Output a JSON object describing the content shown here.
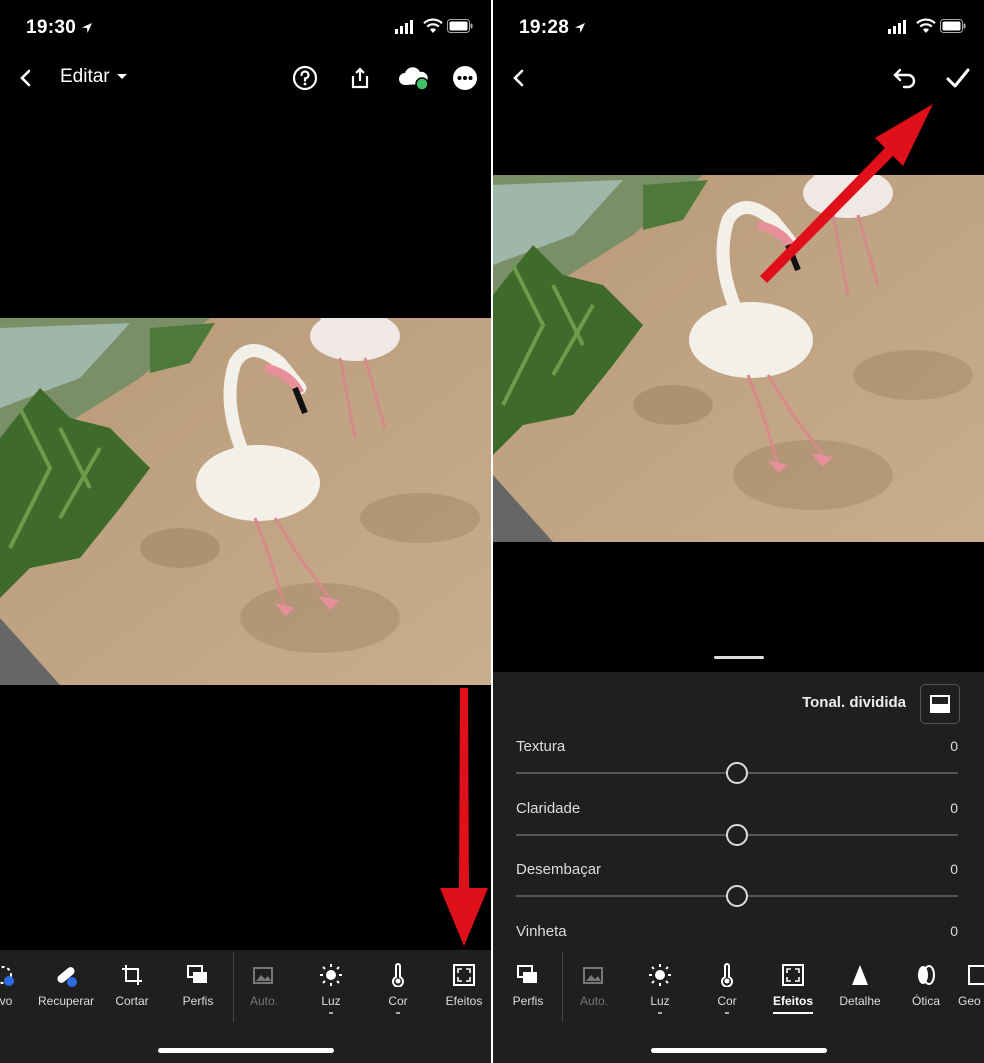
{
  "left": {
    "status": {
      "time": "19:30"
    },
    "header": {
      "title": "Editar"
    },
    "toolbar": {
      "items": [
        {
          "label": "tivo",
          "icon": "selective-icon"
        },
        {
          "label": "Recuperar",
          "icon": "healing-bandage-icon"
        },
        {
          "label": "Cortar",
          "icon": "crop-icon"
        },
        {
          "label": "Perfis",
          "icon": "profiles-icon"
        },
        {
          "label": "Auto.",
          "icon": "auto-image-icon"
        },
        {
          "label": "Luz",
          "icon": "sun-icon"
        },
        {
          "label": "Cor",
          "icon": "thermometer-icon"
        },
        {
          "label": "Efeitos",
          "icon": "effects-frame-icon"
        }
      ]
    }
  },
  "right": {
    "status": {
      "time": "19:28"
    },
    "panel": {
      "tonal_label": "Tonal. dividida",
      "sliders": [
        {
          "label": "Textura",
          "value": "0"
        },
        {
          "label": "Claridade",
          "value": "0"
        },
        {
          "label": "Desembaçar",
          "value": "0"
        },
        {
          "label": "Vinheta",
          "value": "0"
        }
      ]
    },
    "toolbar": {
      "items": [
        {
          "label": "Perfis",
          "icon": "profiles-icon"
        },
        {
          "label": "Auto.",
          "icon": "auto-image-icon"
        },
        {
          "label": "Luz",
          "icon": "sun-icon"
        },
        {
          "label": "Cor",
          "icon": "thermometer-icon"
        },
        {
          "label": "Efeitos",
          "icon": "effects-frame-icon",
          "active": true
        },
        {
          "label": "Detalhe",
          "icon": "detail-triangle-icon"
        },
        {
          "label": "Ótica",
          "icon": "optics-lens-icon"
        },
        {
          "label": "Geo",
          "icon": "geometry-icon"
        }
      ]
    }
  },
  "colors": {
    "background": "#000000",
    "panel": "#1f1f1f",
    "arrow": "#e0101a",
    "sync_dot": "#3fbf6a"
  }
}
